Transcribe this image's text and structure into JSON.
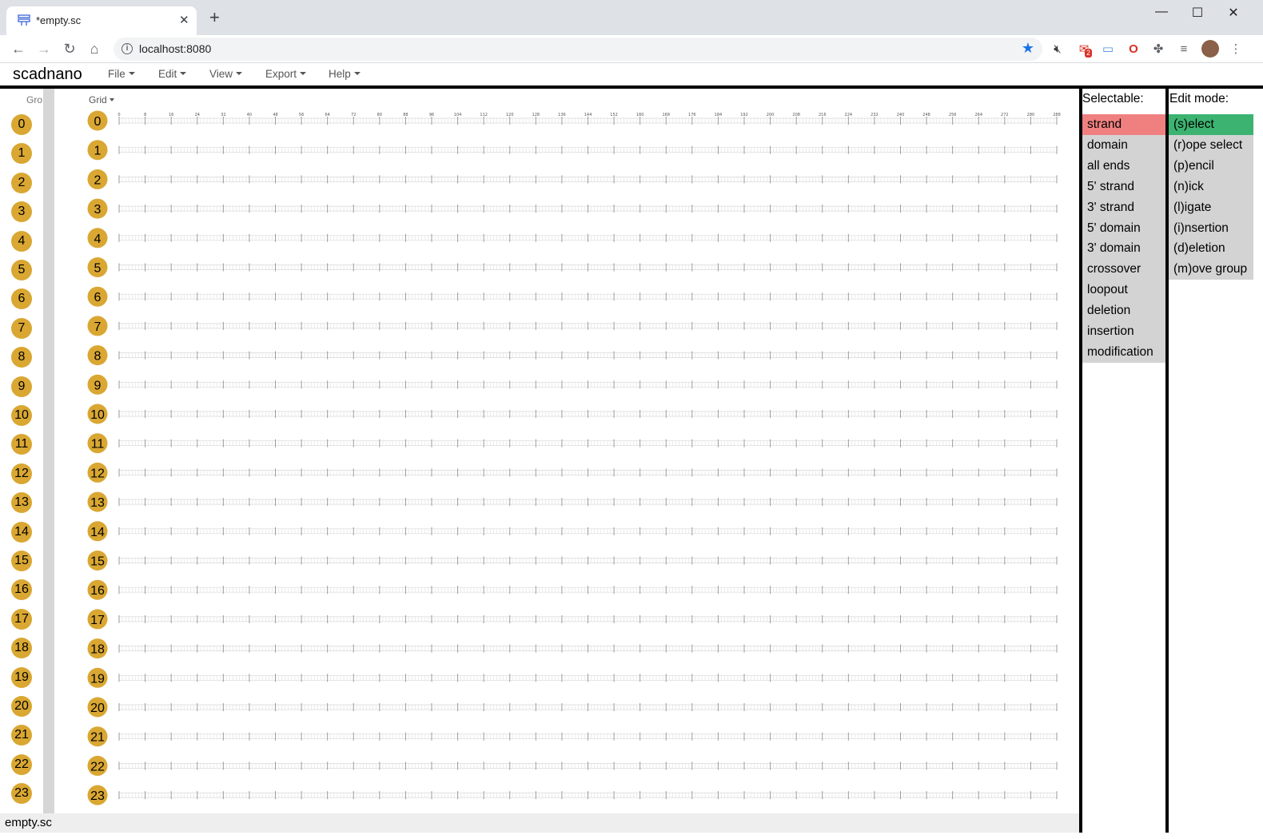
{
  "browser": {
    "tab_title": "*empty.sc",
    "url": "localhost:8080",
    "window_controls": [
      "minimize-icon",
      "maximize-icon",
      "close-icon"
    ],
    "extension_badge": "2"
  },
  "app": {
    "title": "scadnano",
    "menus": [
      "File",
      "Edit",
      "View",
      "Export",
      "Help"
    ]
  },
  "side_view": {
    "dropdown_label": "Gro",
    "helices": [
      "0",
      "1",
      "2",
      "3",
      "4",
      "5",
      "6",
      "7",
      "8",
      "9",
      "10",
      "11",
      "12",
      "13",
      "14",
      "15",
      "16",
      "17",
      "18",
      "19",
      "20",
      "21",
      "22",
      "23"
    ]
  },
  "main_view": {
    "grid_dropdown_label": "Grid",
    "helices": [
      "0",
      "1",
      "2",
      "3",
      "4",
      "5",
      "6",
      "7",
      "8",
      "9",
      "10",
      "11",
      "12",
      "13",
      "14",
      "15",
      "16",
      "17",
      "18",
      "19",
      "20",
      "21",
      "22",
      "23"
    ],
    "ruler_labels": [
      "0",
      "8",
      "16",
      "24",
      "32",
      "40",
      "48",
      "56",
      "64",
      "72",
      "80",
      "88",
      "96",
      "104",
      "112",
      "120",
      "128",
      "136",
      "144",
      "152",
      "160",
      "168",
      "176",
      "184",
      "192",
      "200",
      "208",
      "216",
      "224",
      "232",
      "240",
      "248",
      "256",
      "264",
      "272",
      "280",
      "288"
    ]
  },
  "status": {
    "filename": "empty.sc"
  },
  "selectable": {
    "title": "Selectable:",
    "items": [
      {
        "label": "strand",
        "active": true
      },
      {
        "label": "domain",
        "active": false
      },
      {
        "label": "all ends",
        "active": false
      },
      {
        "label": "5' strand",
        "active": false
      },
      {
        "label": "3' strand",
        "active": false
      },
      {
        "label": "5' domain",
        "active": false
      },
      {
        "label": "3' domain",
        "active": false
      },
      {
        "label": "crossover",
        "active": false
      },
      {
        "label": "loopout",
        "active": false
      },
      {
        "label": "deletion",
        "active": false
      },
      {
        "label": "insertion",
        "active": false
      },
      {
        "label": "modification",
        "active": false
      }
    ]
  },
  "edit_mode": {
    "title": "Edit mode:",
    "items": [
      {
        "label": "(s)elect",
        "active": true
      },
      {
        "label": "(r)ope select",
        "active": false
      },
      {
        "label": "(p)encil",
        "active": false
      },
      {
        "label": "(n)ick",
        "active": false
      },
      {
        "label": "(l)igate",
        "active": false
      },
      {
        "label": "(i)nsertion",
        "active": false
      },
      {
        "label": "(d)eletion",
        "active": false
      },
      {
        "label": "(m)ove group",
        "active": false
      }
    ]
  },
  "colors": {
    "helix_fill": "#d9a732",
    "selectable_active": "#f08080",
    "edit_mode_active": "#3cb371",
    "inactive": "#d3d3d3"
  }
}
